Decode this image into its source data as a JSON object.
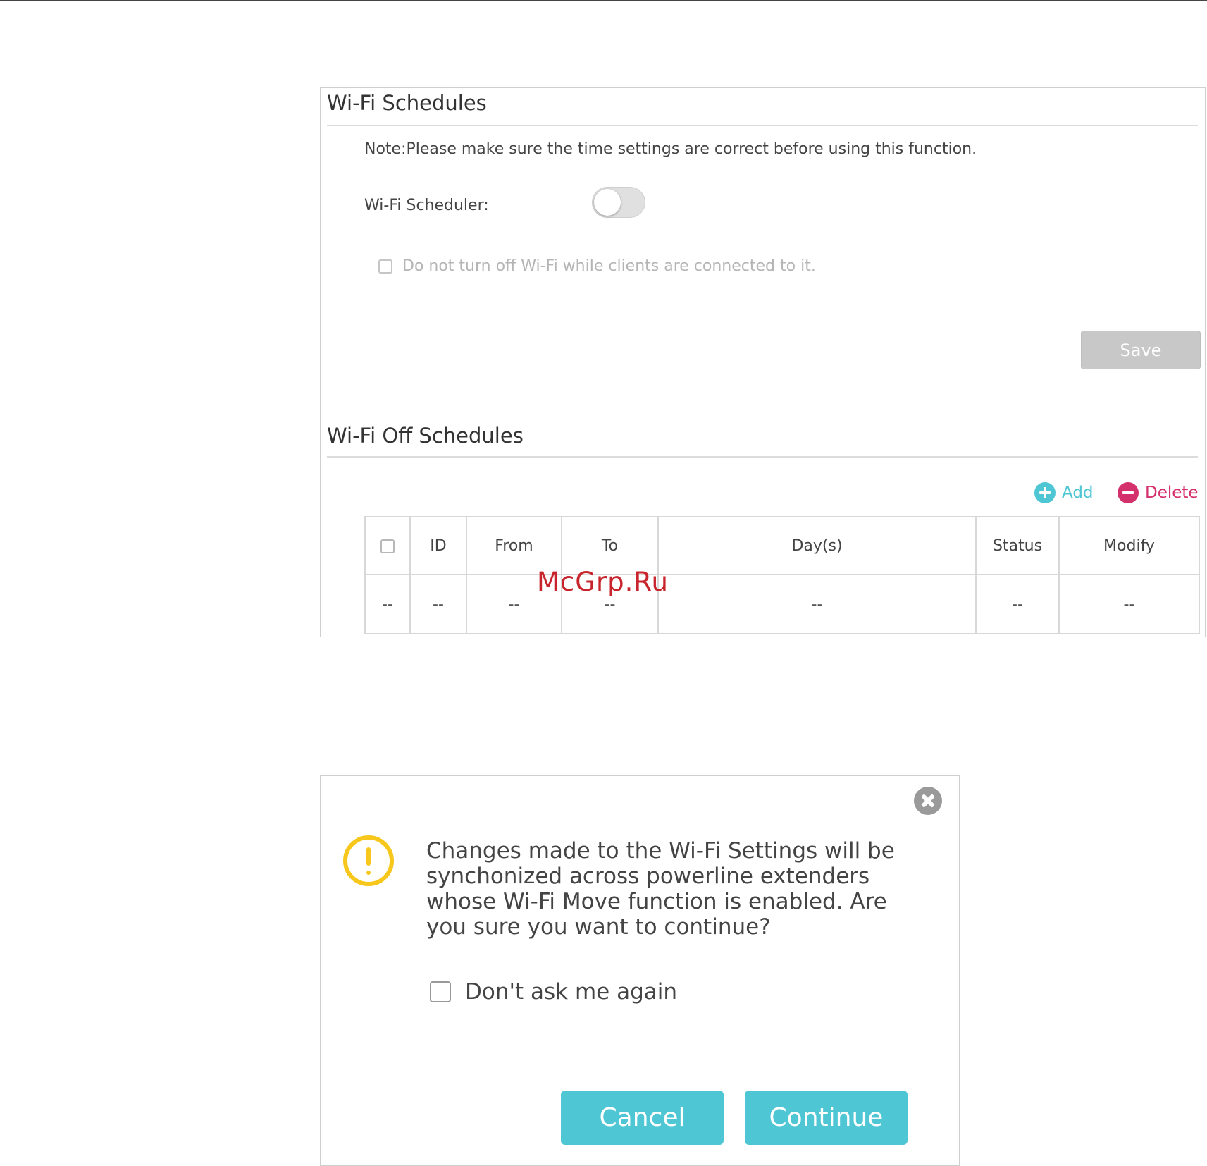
{
  "schedules_panel": {
    "title": "Wi-Fi Schedules",
    "note": "Note:Please make sure the time settings are correct before using this function.",
    "scheduler_label": "Wi-Fi Scheduler:",
    "scheduler_enabled": false,
    "clients_checkbox_label": "Do not turn off Wi-Fi while clients are connected to it.",
    "save_label": "Save"
  },
  "off_schedules": {
    "title": "Wi-Fi Off Schedules",
    "add_label": "Add",
    "delete_label": "Delete",
    "columns": [
      "ID",
      "From",
      "To",
      "Day(s)",
      "Status",
      "Modify"
    ],
    "rows": [
      [
        "--",
        "--",
        "--",
        "--",
        "--",
        "--",
        "--"
      ]
    ]
  },
  "watermark": "McGrp.Ru",
  "dialog": {
    "message": "Changes made to the Wi-Fi Settings will be synchonized across powerline extenders whose Wi-Fi Move function is enabled. Are you sure you want to continue?",
    "dont_ask_label": "Don't ask me again",
    "cancel_label": "Cancel",
    "continue_label": "Continue"
  },
  "colors": {
    "accent": "#4ec6d3",
    "delete": "#d4306c",
    "warning": "#f7c71c",
    "watermark": "#c8242b"
  }
}
